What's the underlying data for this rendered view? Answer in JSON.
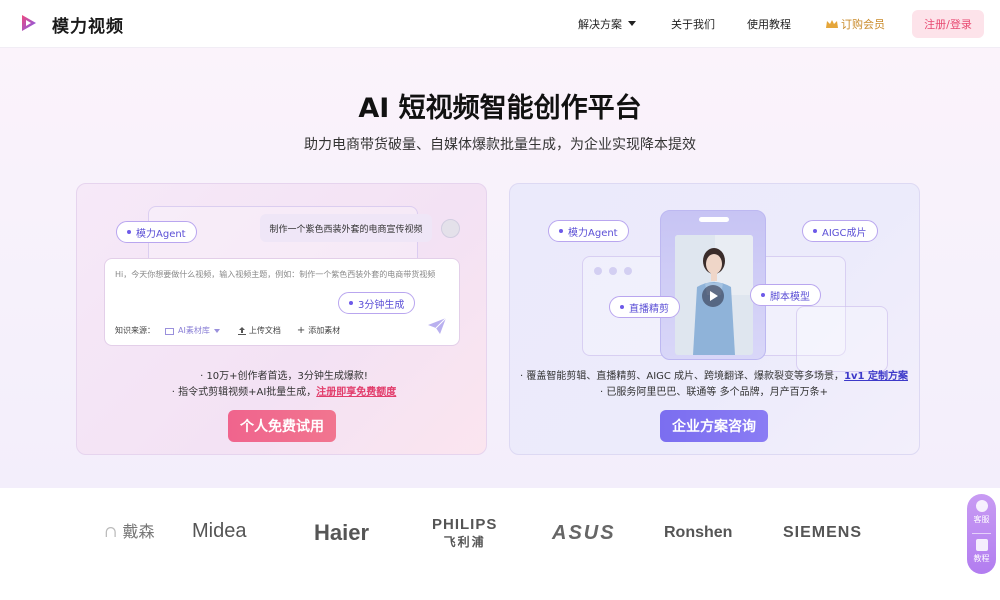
{
  "header": {
    "brand": "模力视频",
    "nav": {
      "solutions": "解决方案",
      "about": "关于我们",
      "tutorial": "使用教程",
      "member": "订购会员"
    },
    "login": "注册/登录"
  },
  "hero": {
    "title": "AI 短视频智能创作平台",
    "subtitle": "助力电商带货破量、自媒体爆款批量生成，为企业实现降本提效"
  },
  "personal_card": {
    "agent_pill": "模力Agent",
    "prompt": "制作一个紫色西装外套的电商宣传视频",
    "chat_placeholder": "Hi，今天你想要做什么视频，输入视频主题，例如：制作一个紫色西装外套的电商带货视频",
    "gen_pill": "3分钟生成",
    "source_label": "知识来源：",
    "source_value": "AI素材库",
    "upload_doc": "上传文档",
    "add_material": "添加素材",
    "bullet1": "10万+创作者首选，3分钟生成爆款!",
    "bullet2_prefix": "指令式剪辑视频+AI批量生成，",
    "bullet2_link": "注册即享免费额度",
    "cta": "个人免费试用"
  },
  "enterprise_card": {
    "agent_pill": "模力Agent",
    "aigc_pill": "AIGC成片",
    "live_pill": "直播精剪",
    "script_pill": "脚本模型",
    "bullet1_prefix": "覆盖智能剪辑、直播精剪、AIGC 成片、跨境翻译、爆款裂变等多场景，",
    "bullet1_link": "1v1 定制方案",
    "bullet2": "已服务阿里巴巴、联通等 多个品牌，月产百万条+",
    "cta": "企业方案咨询"
  },
  "partners": {
    "dyson": "戴森",
    "midea": "Midea",
    "haier": "Haier",
    "philips": "PHILIPS",
    "philips_cn": "飞利浦",
    "asus": "ASUS",
    "ronshen": "Ronshen",
    "siemens": "SIEMENS"
  },
  "side_widget": {
    "service": "客服",
    "tutorial": "教程"
  },
  "colors": {
    "accent_pink": "#f0648d",
    "accent_purple": "#7b6ef0",
    "member_gold": "#c98a2a"
  }
}
